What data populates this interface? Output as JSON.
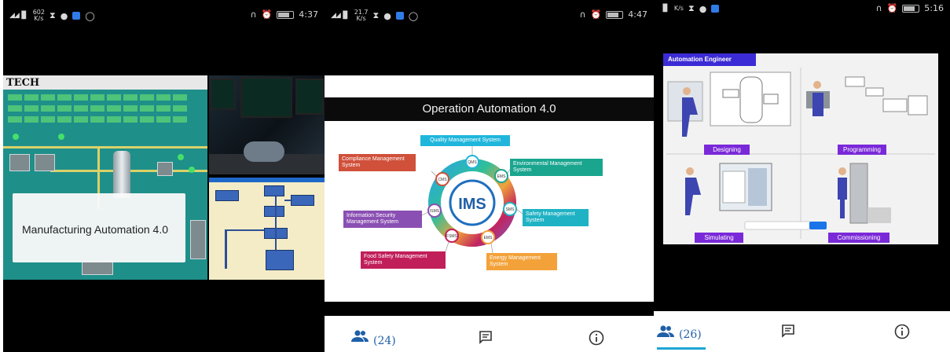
{
  "panels": [
    {
      "status": {
        "speed_top": "602",
        "speed_unit": "K/s",
        "time": "4:37"
      },
      "slide": {
        "logo_text": "TECH",
        "caption": "Manufacturing Automation 4.0"
      }
    },
    {
      "status": {
        "speed_top": "21.7",
        "speed_unit": "K/s",
        "time": "4:47"
      },
      "slide": {
        "title": "Operation Automation 4.0",
        "center": "IMS",
        "ring_labels": [
          "QMS",
          "EMS",
          "SMS",
          "EMS",
          "FSMS",
          "ISMS",
          "CMS"
        ],
        "systems": {
          "quality": "Quality Management System",
          "environmental": "Environmental Management System",
          "safety": "Safety Management System",
          "energy": "Energy Management System",
          "food": "Food Safety Management System",
          "infosec": "Information Security Management System",
          "compliance": "Compliance Management System"
        }
      },
      "nav": {
        "participants_count": "(24)"
      }
    },
    {
      "status": {
        "speed_unit": "K/s",
        "time": "5:16"
      },
      "slide": {
        "header": "Automation Engineer",
        "labels": {
          "designing": "Designing",
          "programming": "Programming",
          "simulating": "Simulating",
          "commissioning": "Commissioning"
        }
      },
      "nav": {
        "participants_count": "(26)"
      }
    }
  ],
  "colors": {
    "accent": "#1f5fa8",
    "quality": "#20b6dc",
    "environmental": "#1aa58f",
    "safety": "#1fb2c4",
    "energy": "#f3a23a",
    "food": "#c11f5a",
    "infosec": "#8a4fb3",
    "compliance": "#d0503a",
    "engineer_header": "#3b2bd6",
    "engineer_labels": "#7a29d8"
  },
  "icons": [
    "people-icon",
    "chat-icon",
    "info-icon",
    "alarm-icon",
    "headset-icon",
    "battery-icon",
    "whatsapp-icon",
    "signal-icon"
  ]
}
